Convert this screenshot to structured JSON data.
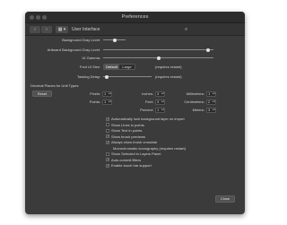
{
  "window": {
    "title": "Preferences"
  },
  "toolbar": {
    "back_label": "‹",
    "forward_label": "›",
    "grid_label": "▦ ▾",
    "section_label": "User Interface",
    "search_icon": "⌕"
  },
  "sliders": [
    {
      "label": "Background Gray Level:",
      "value": 0.5
    },
    {
      "label": "Artboard Background Gray Level:",
      "value": 0.95
    },
    {
      "label": "UI Gamma:",
      "value": 0.5
    },
    {
      "label": "Tasking Delay:",
      "value": 0.08
    }
  ],
  "font_ui_size": {
    "label": "Font UI Size:",
    "options": [
      "Default",
      "Large"
    ],
    "selected": "Default",
    "note": "(requires restart)"
  },
  "tasking_note": "(requires restart)",
  "decimal_places": {
    "heading": "Decimal Places for Unit Types:",
    "reset_label": "Reset",
    "units": [
      {
        "label": "Pixels:",
        "value": "1"
      },
      {
        "label": "Points:",
        "value": "1"
      },
      {
        "label": "Inches:",
        "value": "3"
      },
      {
        "label": "Feet:",
        "value": "3"
      },
      {
        "label": "Percent:",
        "value": "1"
      },
      {
        "label": "Millimeters:",
        "value": "1"
      },
      {
        "label": "Centimeters:",
        "value": "2"
      },
      {
        "label": "Meters:",
        "value": "3"
      }
    ]
  },
  "checkboxes": [
    {
      "label": "Automatically lock background layer on import",
      "checked": true
    },
    {
      "label": "Show Lines in points",
      "checked": false
    },
    {
      "label": "Show Text in points",
      "checked": false
    },
    {
      "label": "Show brush previews",
      "checked": true
    },
    {
      "label": "Always show brush crosshair",
      "checked": true
    },
    {
      "label": "Monochromatic iconography (requires restart)",
      "checked": false,
      "indented": true
    },
    {
      "label": "Show Selected in Layers Panel",
      "checked": false
    },
    {
      "label": "Auto-commit filters",
      "checked": true
    },
    {
      "label": "Enable touch bar support",
      "checked": true
    }
  ],
  "footer": {
    "close_label": "Close"
  },
  "colors": {
    "window_bg": "#3b3b3b",
    "titlebar_bg": "#2c2c2c",
    "knob": "#e4e4e4"
  }
}
